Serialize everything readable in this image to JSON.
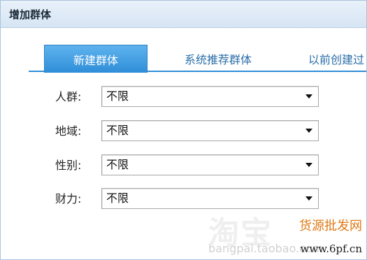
{
  "header": {
    "title": "增加群体"
  },
  "tabs": [
    {
      "label": "新建群体",
      "active": true
    },
    {
      "label": "系统推荐群体",
      "active": false
    },
    {
      "label": "以前创建过",
      "active": false
    }
  ],
  "filters": [
    {
      "label": "人群:",
      "value": "不限"
    },
    {
      "label": "地域:",
      "value": "不限"
    },
    {
      "label": "性别:",
      "value": "不限"
    },
    {
      "label": "财力:",
      "value": "不限"
    }
  ],
  "watermark": {
    "logo_text": "淘宝",
    "brand_text": "货源批发网",
    "url_left": "bangpai.taobao.com",
    "url_right": "www.6pf.cn"
  },
  "colors": {
    "accent": "#2f8ed8",
    "title_bg": "#dbe8f5",
    "brand": "#e07a14"
  }
}
